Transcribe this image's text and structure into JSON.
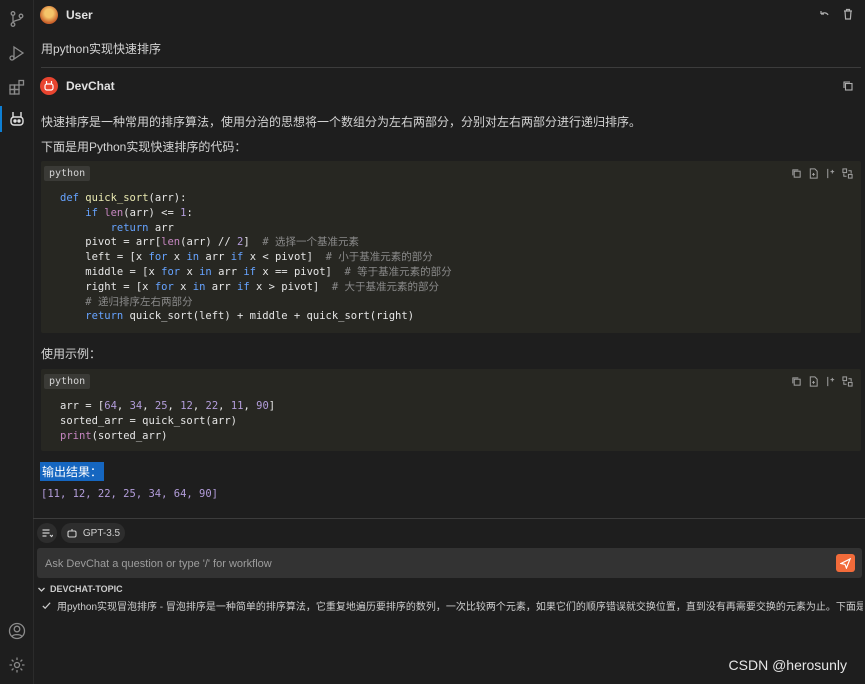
{
  "user": {
    "name": "User",
    "message": "用python实现快速排序"
  },
  "bot": {
    "name": "DevChat",
    "intro": "快速排序是一种常用的排序算法，使用分治的思想将一个数组分为左右两部分，分别对左右两部分进行递归排序。",
    "code_intro": "下面是用Python实现快速排序的代码：",
    "code1_lang": "python",
    "example_label": "使用示例：",
    "code2_lang": "python",
    "output_label": "输出结果：",
    "output_value": "[11, 12, 22, 25, 34, 64, 90]"
  },
  "input": {
    "placeholder": "Ask DevChat a question or type '/' for workflow"
  },
  "model": {
    "label": "GPT-3.5"
  },
  "topic": {
    "header": "DEVCHAT-TOPIC",
    "item": "用python实现冒泡排序 - ‍冒泡排序是一种简单的排序算法，它重复地遍历要排序的数列，一次比较两个元素，如果它们的顺序错误就交换位置，直到没有再需要交换的元素为止。‍‍下面是用Pytho..."
  },
  "watermark": "CSDN @herosunly",
  "colors": {
    "accent": "#0e7fd4",
    "send": "#f26b3a",
    "selection": "#1566c0"
  }
}
